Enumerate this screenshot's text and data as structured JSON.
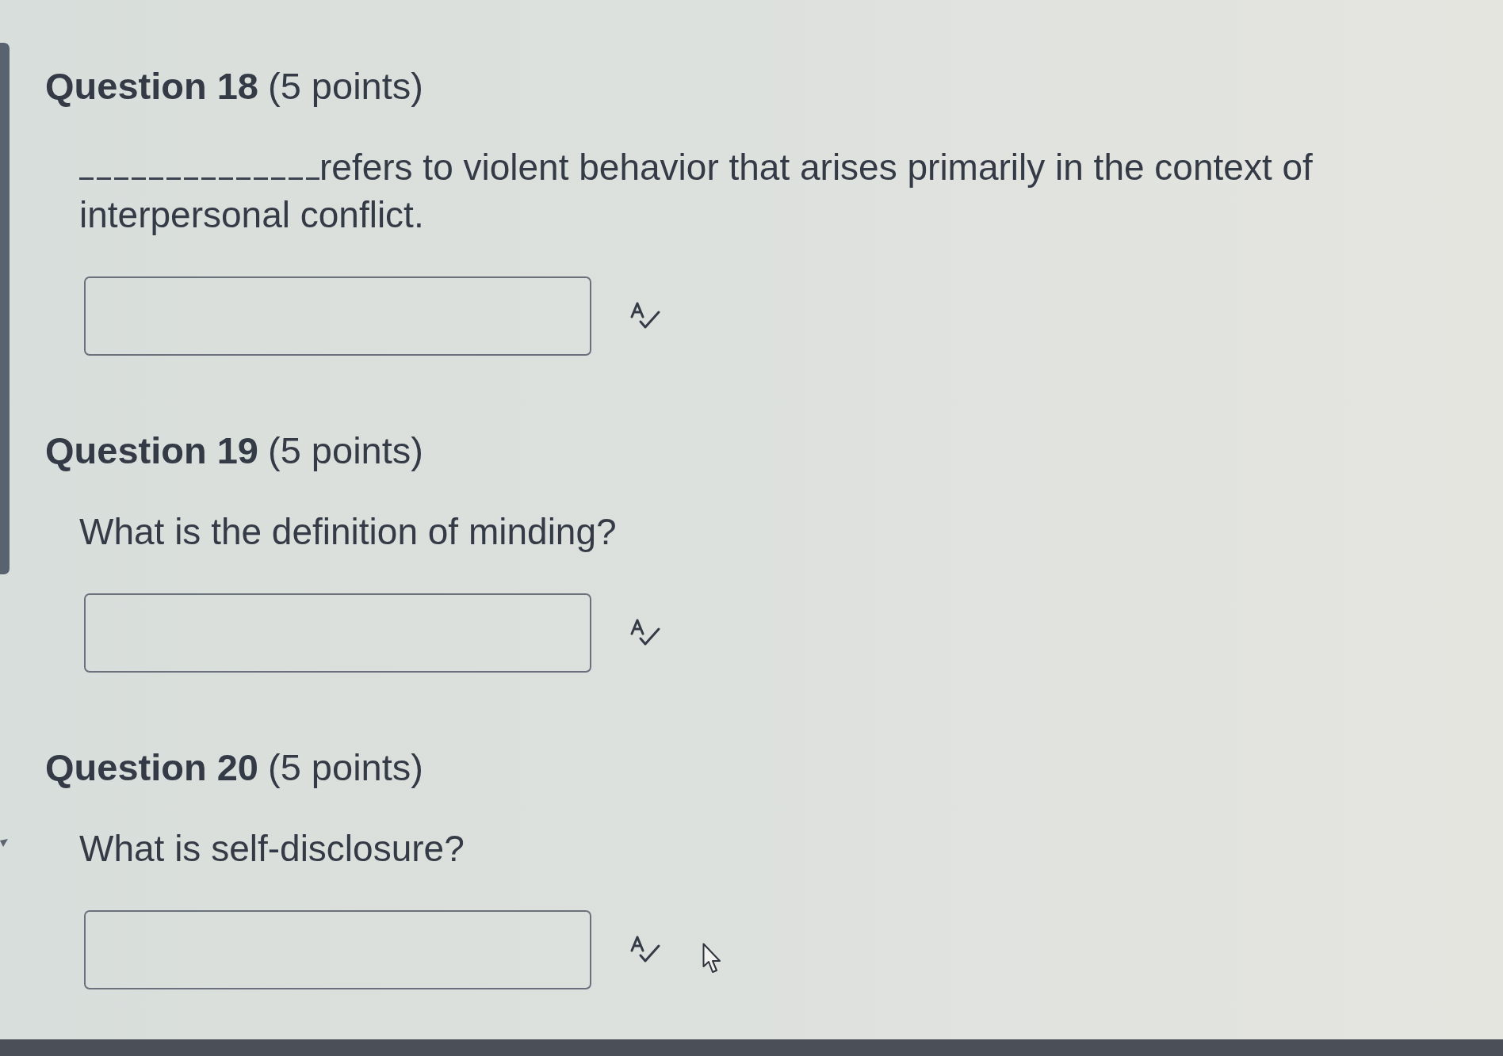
{
  "questions": [
    {
      "title": "Question 18",
      "points": "(5 points)",
      "leading_blank": true,
      "prompt": "refers to violent behavior that arises primarily in the context of interpersonal conflict."
    },
    {
      "title": "Question 19",
      "points": "(5 points)",
      "leading_blank": false,
      "prompt": "What is the definition of minding?"
    },
    {
      "title": "Question 20",
      "points": "(5 points)",
      "leading_blank": false,
      "prompt": "What is self-disclosure?"
    }
  ]
}
